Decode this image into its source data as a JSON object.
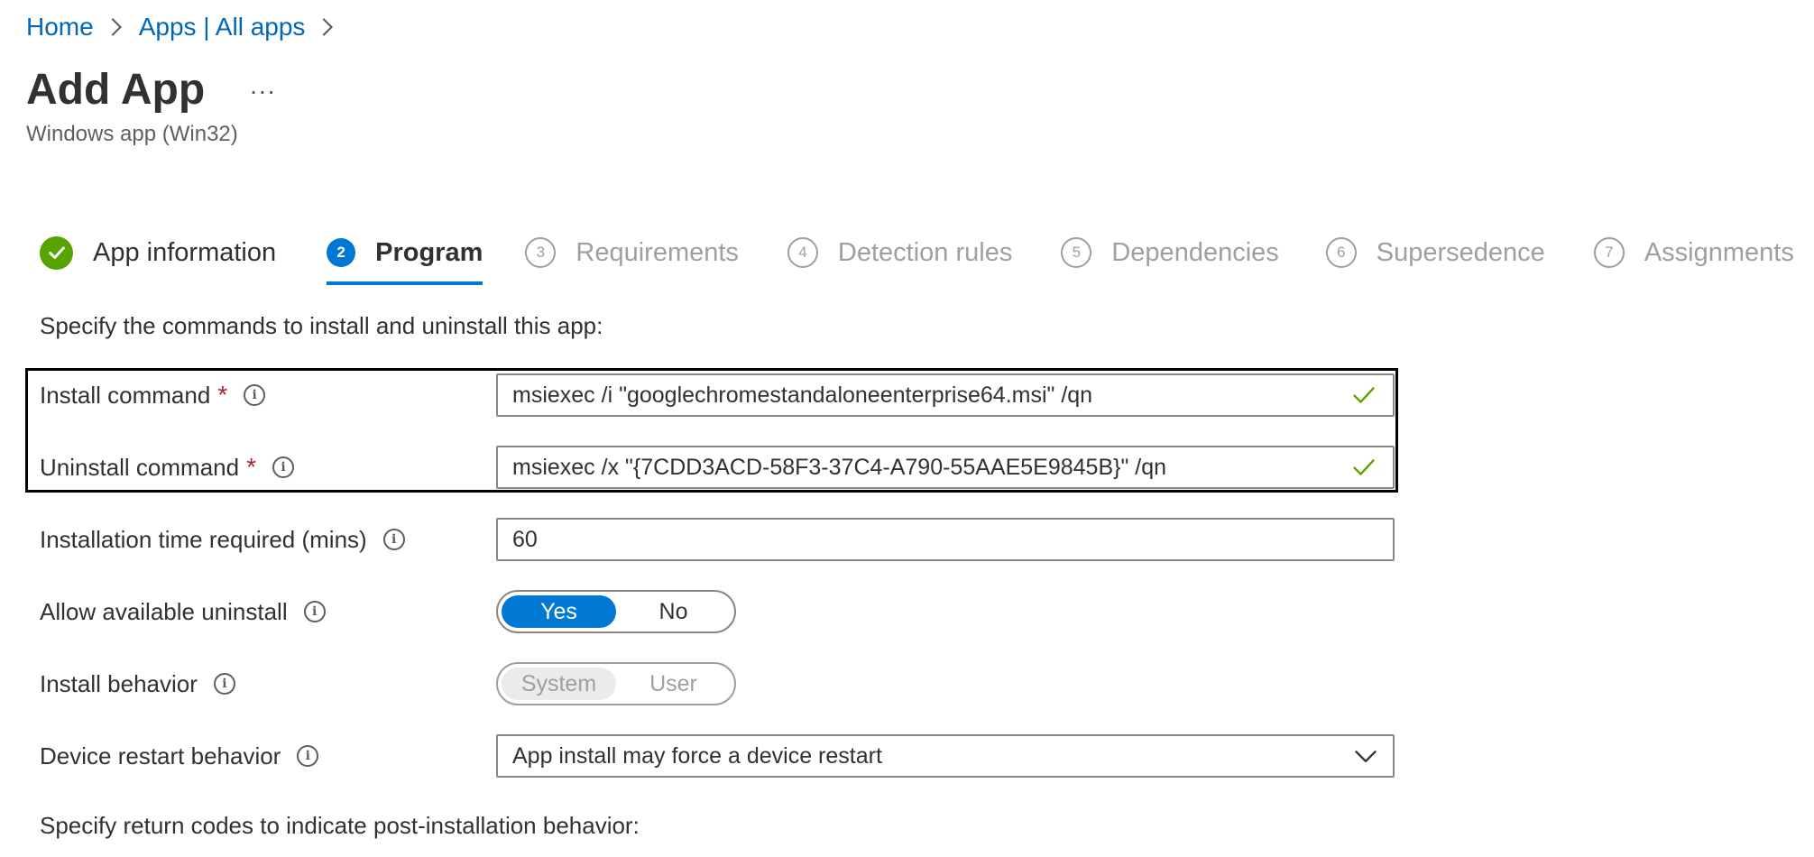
{
  "breadcrumb": {
    "home": "Home",
    "apps": "Apps | All apps"
  },
  "title": "Add App",
  "more_label": "...",
  "subtitle": "Windows app (Win32)",
  "steps": [
    {
      "number": "",
      "label": "App information",
      "state": "done"
    },
    {
      "number": "2",
      "label": "Program",
      "state": "active"
    },
    {
      "number": "3",
      "label": "Requirements",
      "state": "todo"
    },
    {
      "number": "4",
      "label": "Detection rules",
      "state": "todo"
    },
    {
      "number": "5",
      "label": "Dependencies",
      "state": "todo"
    },
    {
      "number": "6",
      "label": "Supersedence",
      "state": "todo"
    },
    {
      "number": "7",
      "label": "Assignments",
      "state": "todo"
    }
  ],
  "intro": "Specify the commands to install and uninstall this app:",
  "form": {
    "install_command": {
      "label": "Install command",
      "required_mark": "*",
      "value": "msiexec /i \"googlechromestandaloneenterprise64.msi\" /qn"
    },
    "uninstall_command": {
      "label": "Uninstall command",
      "required_mark": "*",
      "value": "msiexec /x \"{7CDD3ACD-58F3-37C4-A790-55AAE5E9845B}\" /qn"
    },
    "install_time": {
      "label": "Installation time required (mins)",
      "value": "60"
    },
    "allow_uninstall": {
      "label": "Allow available uninstall",
      "yes": "Yes",
      "no": "No",
      "selected": "Yes"
    },
    "install_behavior": {
      "label": "Install behavior",
      "system": "System",
      "user": "User",
      "selected": "System"
    },
    "restart_behavior": {
      "label": "Device restart behavior",
      "value": "App install may force a device restart"
    }
  },
  "return_codes_intro": "Specify return codes to indicate post-installation behavior:",
  "info_glyph": "i",
  "colors": {
    "accent": "#0078d4",
    "success": "#57a300",
    "required": "#a4262c",
    "link": "#0067b8"
  }
}
